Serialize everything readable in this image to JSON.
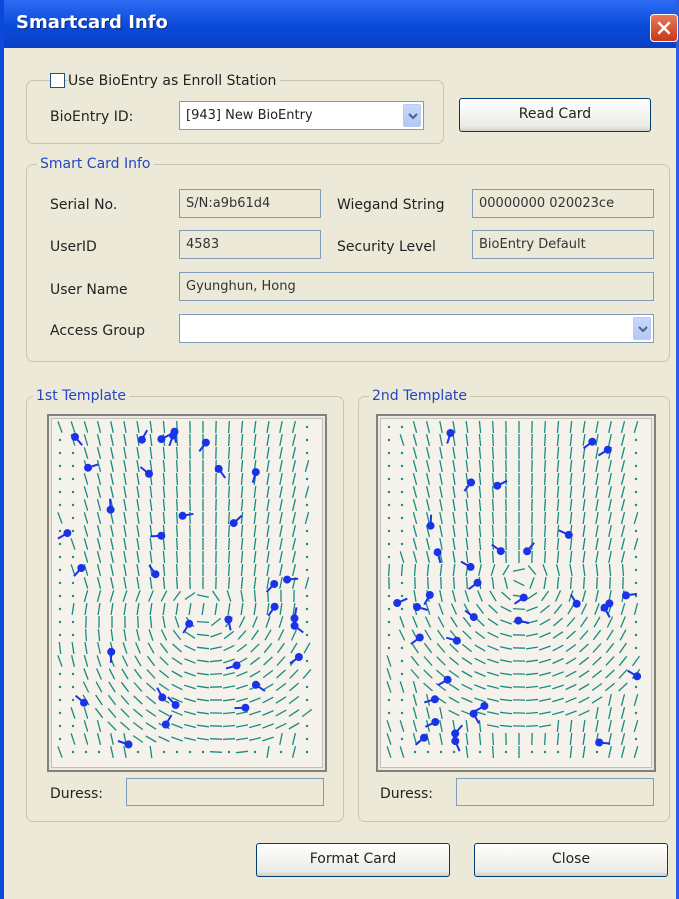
{
  "window": {
    "title": "Smartcard Info"
  },
  "enroll": {
    "use_bioentry_label": "Use BioEntry as Enroll Station",
    "bioentry_id_label": "BioEntry ID:",
    "bioentry_id_value": "[943] New BioEntry",
    "read_card_label": "Read Card"
  },
  "card_info": {
    "group_label": "Smart Card Info",
    "serial_label": "Serial No.",
    "serial_value": "S/N:a9b61d4",
    "wiegand_label": "Wiegand String",
    "wiegand_value": "00000000 020023ce",
    "userid_label": "UserID",
    "userid_value": "4583",
    "security_label": "Security Level",
    "security_value": "BioEntry Default",
    "username_label": "User Name",
    "username_value": "Gyunghun, Hong",
    "access_group_label": "Access Group",
    "access_group_value": ""
  },
  "template1": {
    "label": "1st Template",
    "duress_label": "Duress:",
    "duress_value": ""
  },
  "template2": {
    "label": "2nd Template",
    "duress_label": "Duress:",
    "duress_value": ""
  },
  "buttons": {
    "format_label": "Format Card",
    "close_label": "Close"
  },
  "colors": {
    "titlebar": "#0a4ad8",
    "accent_text": "#2446c4",
    "ridge": "#1a8a80",
    "minutia": "#1a33e6"
  },
  "icons": [
    "close-icon",
    "checkbox",
    "dropdown-arrow-icon"
  ]
}
